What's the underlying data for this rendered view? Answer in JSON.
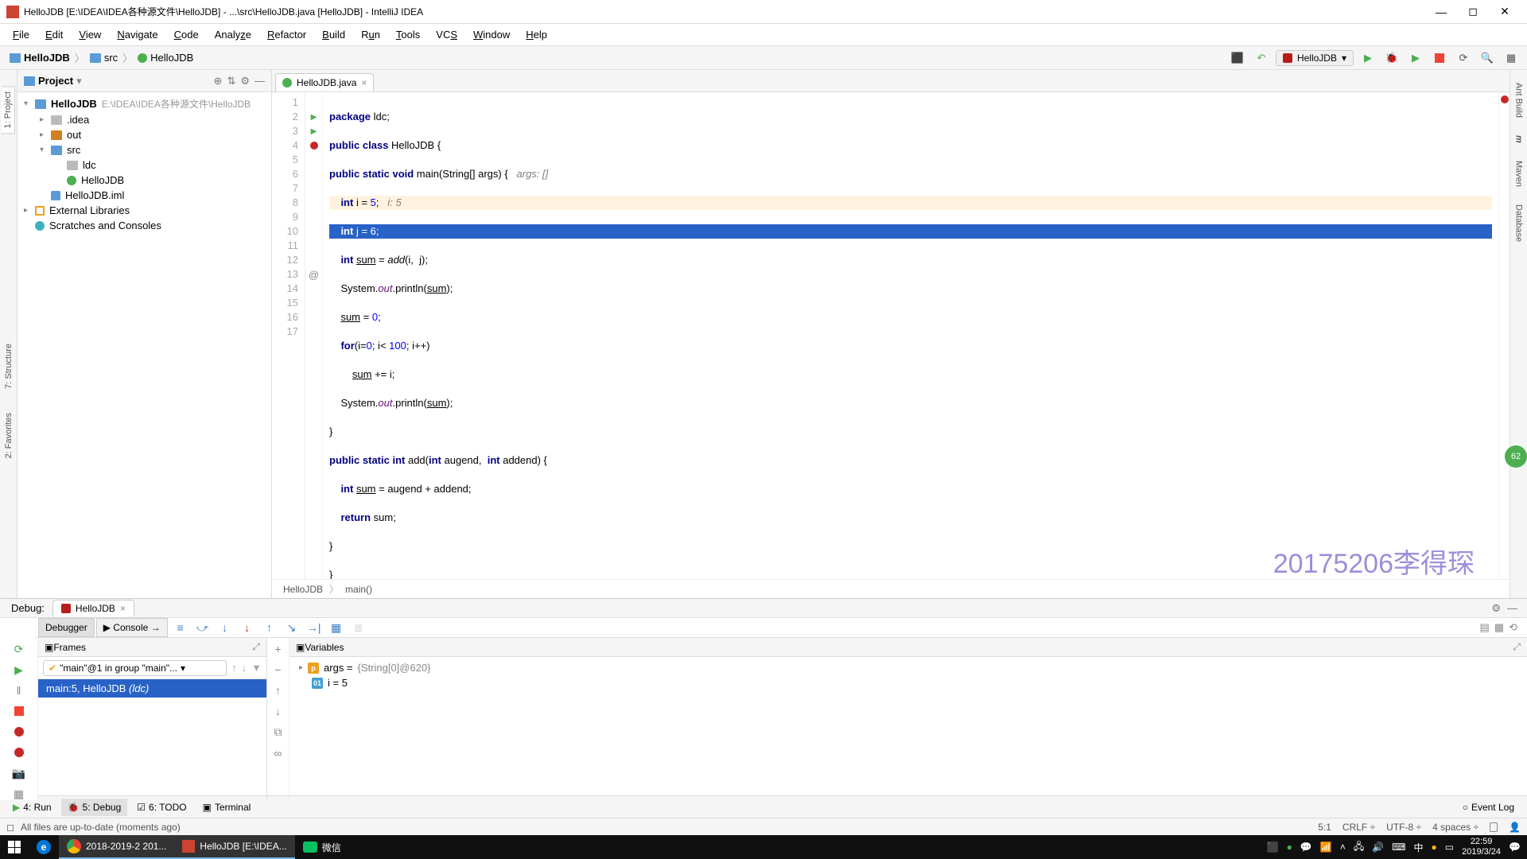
{
  "window": {
    "title": "HelloJDB [E:\\IDEA\\IDEA各种源文件\\HelloJDB] - ...\\src\\HelloJDB.java [HelloJDB] - IntelliJ IDEA"
  },
  "menus": [
    "File",
    "Edit",
    "View",
    "Navigate",
    "Code",
    "Analyze",
    "Refactor",
    "Build",
    "Run",
    "Tools",
    "VCS",
    "Window",
    "Help"
  ],
  "breadcrumbs": {
    "root": "HelloJDB",
    "folder": "src",
    "file": "HelloJDB"
  },
  "runconfig": {
    "name": "HelloJDB"
  },
  "project": {
    "title": "Project",
    "root": "HelloJDB",
    "root_path": "E:\\IDEA\\IDEA各种源文件\\HelloJDB",
    "idea": ".idea",
    "out": "out",
    "src": "src",
    "ldc": "ldc",
    "file_class": "HelloJDB",
    "file_iml": "HelloJDB.iml",
    "ext_lib": "External Libraries",
    "scratches": "Scratches and Consoles"
  },
  "lefttabs": {
    "project": "1: Project",
    "structure": "7: Structure",
    "favorites": "2: Favorites"
  },
  "righttabs": {
    "ant": "Ant Build",
    "maven": "Maven",
    "database": "Database"
  },
  "tab": {
    "name": "HelloJDB.java"
  },
  "code": {
    "l1a": "package ",
    "l1b": "ldc",
    "l1c": ";",
    "l2a": "public class ",
    "l2b": "HelloJDB {",
    "l3a": "public static void ",
    "l3b": "main(String[] args) {   ",
    "l3c": "args: []",
    "l4a": "    int ",
    "l4b": "i = ",
    "l4c": "5",
    "l4d": ";   ",
    "l4e": "i: 5",
    "l5a": "    int ",
    "l5b": "j = ",
    "l5c": "6",
    "l5d": ";",
    "l6a": "    int ",
    "l6b": "sum",
    "l6c": " = ",
    "l6d": "add",
    "l6e": "(i,  j);",
    "l7a": "    System.",
    "l7b": "out",
    "l7c": ".println(",
    "l7d": "sum",
    "l7e": ");",
    "l8a": "    ",
    "l8b": "sum",
    "l8c": " = ",
    "l8d": "0",
    "l8e": ";",
    "l9a": "    for",
    "l9b": "(i=",
    "l9c": "0",
    "l9d": "; i< ",
    "l9e": "100",
    "l9f": "; i++)",
    "l10a": "        ",
    "l10b": "sum",
    "l10c": " += i;",
    "l11a": "    System.",
    "l11b": "out",
    "l11c": ".println(",
    "l11d": "sum",
    "l11e": ");",
    "l12": "}",
    "l13a": "public static int ",
    "l13b": "add(",
    "l13c": "int ",
    "l13d": "augend,  ",
    "l13e": "int ",
    "l13f": "addend) {",
    "l14a": "    int ",
    "l14b": "sum",
    "l14c": " = augend + addend;",
    "l15a": "    return ",
    "l15b": "sum",
    "l15c": ";",
    "l16": "}",
    "l17": "}"
  },
  "crumb2": {
    "class": "HelloJDB",
    "method": "main()"
  },
  "watermark": "20175206李得琛",
  "debug": {
    "label": "Debug:",
    "tabname": "HelloJDB",
    "sub_debugger": "Debugger",
    "sub_console": "Console",
    "frames_title": "Frames",
    "thread_sel": "\"main\"@1 in group \"main\"...",
    "frame0": "main:5, HelloJDB ",
    "frame0_pkg": "(ldc)",
    "vars_title": "Variables",
    "var_args": "args = ",
    "var_args_val": "{String[0]@620}",
    "var_i": "i = 5"
  },
  "toolwin": {
    "run": "4: Run",
    "debug": "5: Debug",
    "todo": "6: TODO",
    "terminal": "Terminal",
    "eventlog": "Event Log"
  },
  "status": {
    "msg": "All files are up-to-date (moments ago)",
    "pos": "5:1",
    "eol": "CRLF",
    "enc": "UTF-8",
    "indent": "4 spaces"
  },
  "taskbar": {
    "chrome_title": "2018-2019-2 201...",
    "ij_title": "HelloJDB [E:\\IDEA...",
    "wechat": "微信",
    "time": "22:59",
    "date": "2019/3/24",
    "ime": "中"
  },
  "ball": "62"
}
